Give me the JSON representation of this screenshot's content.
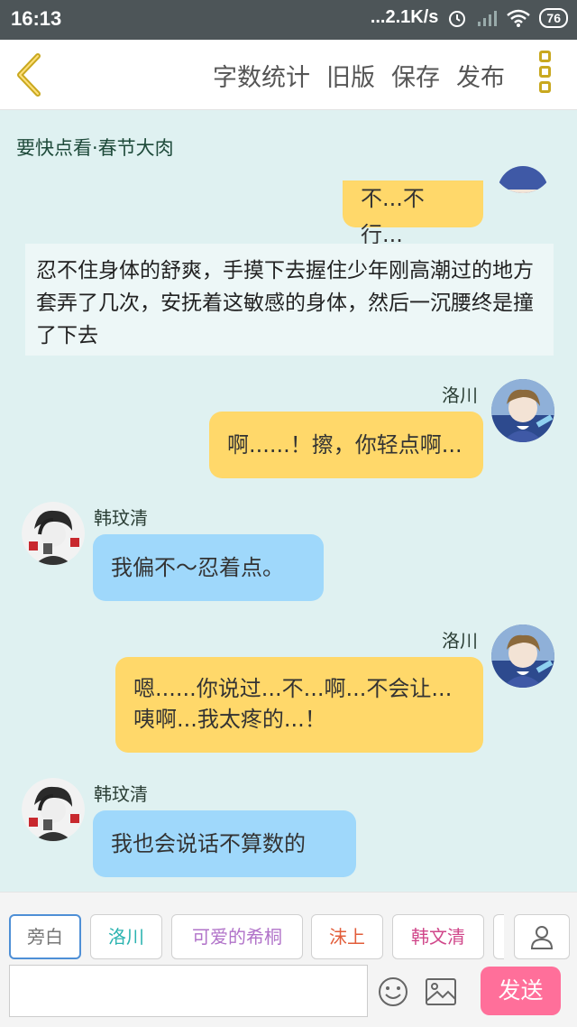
{
  "status": {
    "time": "16:13",
    "speed": "...2.1K/s",
    "battery": "76"
  },
  "toolbar": {
    "actions": [
      "字数统计",
      "旧版",
      "保存",
      "发布"
    ]
  },
  "story": {
    "title": "要快点看·春节大肉"
  },
  "messages": [
    {
      "type": "right",
      "text": "不...不行..."
    },
    {
      "type": "narration",
      "text": "忍不住身体的舒爽，手摸下去握住少年刚高潮过的地方套弄了几次，安抚着这敏感的身体，然后一沉腰终是撞了下去"
    },
    {
      "type": "right",
      "speaker": "洛川",
      "text": "啊......！擦，你轻点啊..."
    },
    {
      "type": "left",
      "speaker": "韩玟清",
      "text": "我偏不～忍着点。"
    },
    {
      "type": "right",
      "speaker": "洛川",
      "line1": "嗯......你说过...不...啊...不会让...",
      "line2": "咦啊...我太疼的...！"
    },
    {
      "type": "left",
      "speaker": "韩玟清",
      "text": "我也会说话不算数的"
    }
  ],
  "characters": [
    {
      "label": "旁白",
      "color": "#777777"
    },
    {
      "label": "洛川",
      "color": "#2bb3b0"
    },
    {
      "label": "可爱的希桐",
      "color": "#b173c9"
    },
    {
      "label": "沫上",
      "color": "#e25d3a"
    },
    {
      "label": "韩文清",
      "color": "#d0478a"
    }
  ],
  "composer": {
    "send_label": "发送",
    "placeholder": ""
  },
  "icons": [
    "back-arrow-icon",
    "menu-icon",
    "emoji-icon",
    "image-icon",
    "user-icon",
    "wifi-icon",
    "signal-icon",
    "alarm-icon"
  ]
}
